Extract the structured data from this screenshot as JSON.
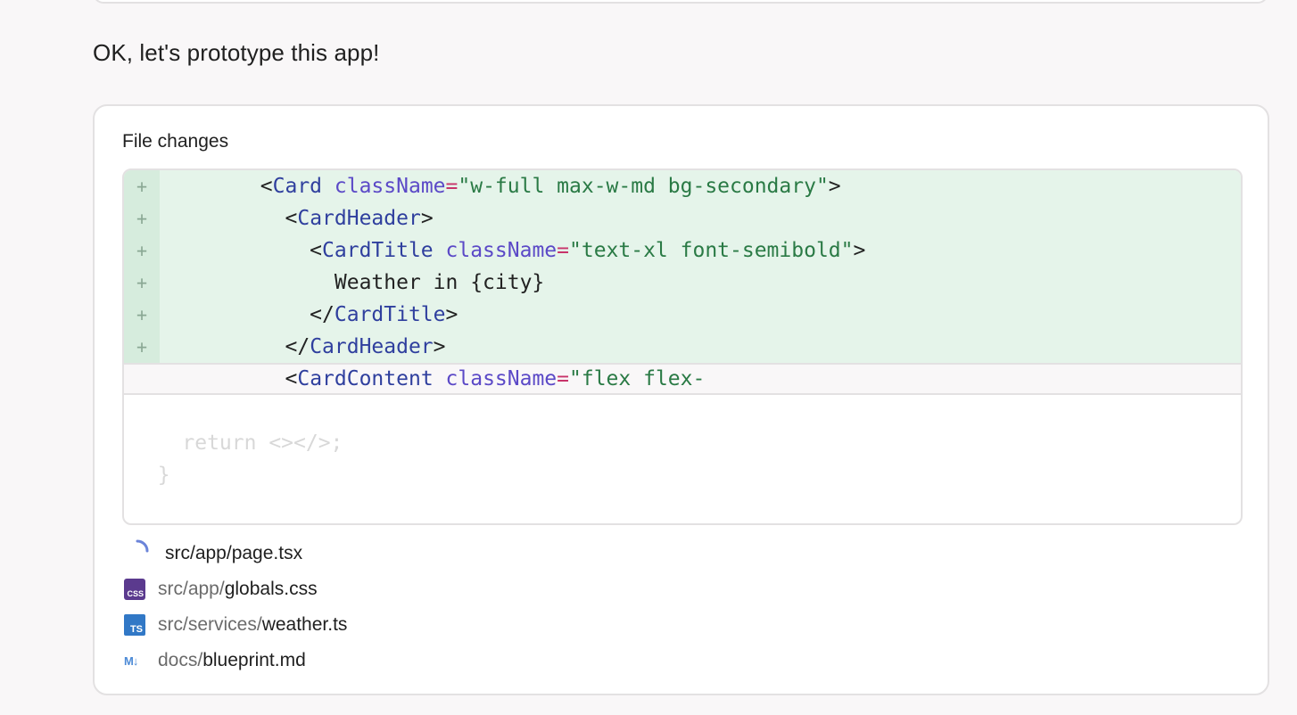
{
  "message": {
    "text": "OK, let's prototype this app!"
  },
  "file_changes": {
    "title": "File changes",
    "diff_lines": [
      {
        "type": "added",
        "marker": "+",
        "indent": "        ",
        "parts": [
          {
            "k": "t-txt",
            "v": "<"
          },
          {
            "k": "t-tag",
            "v": "Card"
          },
          {
            "k": "t-txt",
            "v": " "
          },
          {
            "k": "t-attr",
            "v": "className"
          },
          {
            "k": "t-eq",
            "v": "="
          },
          {
            "k": "t-str",
            "v": "\"w-full max-w-md bg-secondary\""
          },
          {
            "k": "t-txt",
            "v": ">"
          }
        ]
      },
      {
        "type": "added",
        "marker": "+",
        "indent": "          ",
        "parts": [
          {
            "k": "t-txt",
            "v": "<"
          },
          {
            "k": "t-tag",
            "v": "CardHeader"
          },
          {
            "k": "t-txt",
            "v": ">"
          }
        ]
      },
      {
        "type": "added",
        "marker": "+",
        "indent": "            ",
        "parts": [
          {
            "k": "t-txt",
            "v": "<"
          },
          {
            "k": "t-tag",
            "v": "CardTitle"
          },
          {
            "k": "t-txt",
            "v": " "
          },
          {
            "k": "t-attr",
            "v": "className"
          },
          {
            "k": "t-eq",
            "v": "="
          },
          {
            "k": "t-str",
            "v": "\"text-xl font-semibold\""
          },
          {
            "k": "t-txt",
            "v": ">"
          }
        ]
      },
      {
        "type": "added",
        "marker": "+",
        "indent": "              ",
        "parts": [
          {
            "k": "t-txt",
            "v": "Weather in {city}"
          }
        ]
      },
      {
        "type": "added",
        "marker": "+",
        "indent": "            ",
        "parts": [
          {
            "k": "t-txt",
            "v": "</"
          },
          {
            "k": "t-tag",
            "v": "CardTitle"
          },
          {
            "k": "t-txt",
            "v": ">"
          }
        ]
      },
      {
        "type": "added",
        "marker": "+",
        "indent": "          ",
        "parts": [
          {
            "k": "t-txt",
            "v": "</"
          },
          {
            "k": "t-tag",
            "v": "CardHeader"
          },
          {
            "k": "t-txt",
            "v": ">"
          }
        ]
      },
      {
        "type": "context",
        "marker": "",
        "indent": "          ",
        "parts": [
          {
            "k": "t-txt",
            "v": "<"
          },
          {
            "k": "t-tag",
            "v": "CardContent"
          },
          {
            "k": "t-txt",
            "v": " "
          },
          {
            "k": "t-attr",
            "v": "className"
          },
          {
            "k": "t-eq",
            "v": "="
          },
          {
            "k": "t-str",
            "v": "\"flex flex-"
          }
        ]
      }
    ],
    "ghost_lines": [
      "    return <></>;",
      "  }"
    ],
    "files": [
      {
        "icon": "spinner-icon",
        "dir": "",
        "name": "src/app/page.tsx"
      },
      {
        "icon": "css-file-icon",
        "icon_label": "CSS",
        "dir": "src/app/",
        "name": "globals.css"
      },
      {
        "icon": "typescript-file-icon",
        "icon_label": "TS",
        "dir": "src/services/",
        "name": "weather.ts"
      },
      {
        "icon": "markdown-file-icon",
        "icon_label": "M↓",
        "dir": "docs/",
        "name": "blueprint.md"
      }
    ]
  },
  "colors": {
    "added_bg": "#e5f4ea",
    "spinner": "#6b84d9",
    "css_icon": "#5b3a8e",
    "ts_icon": "#3178c6",
    "md_icon": "#4c8ad6"
  }
}
